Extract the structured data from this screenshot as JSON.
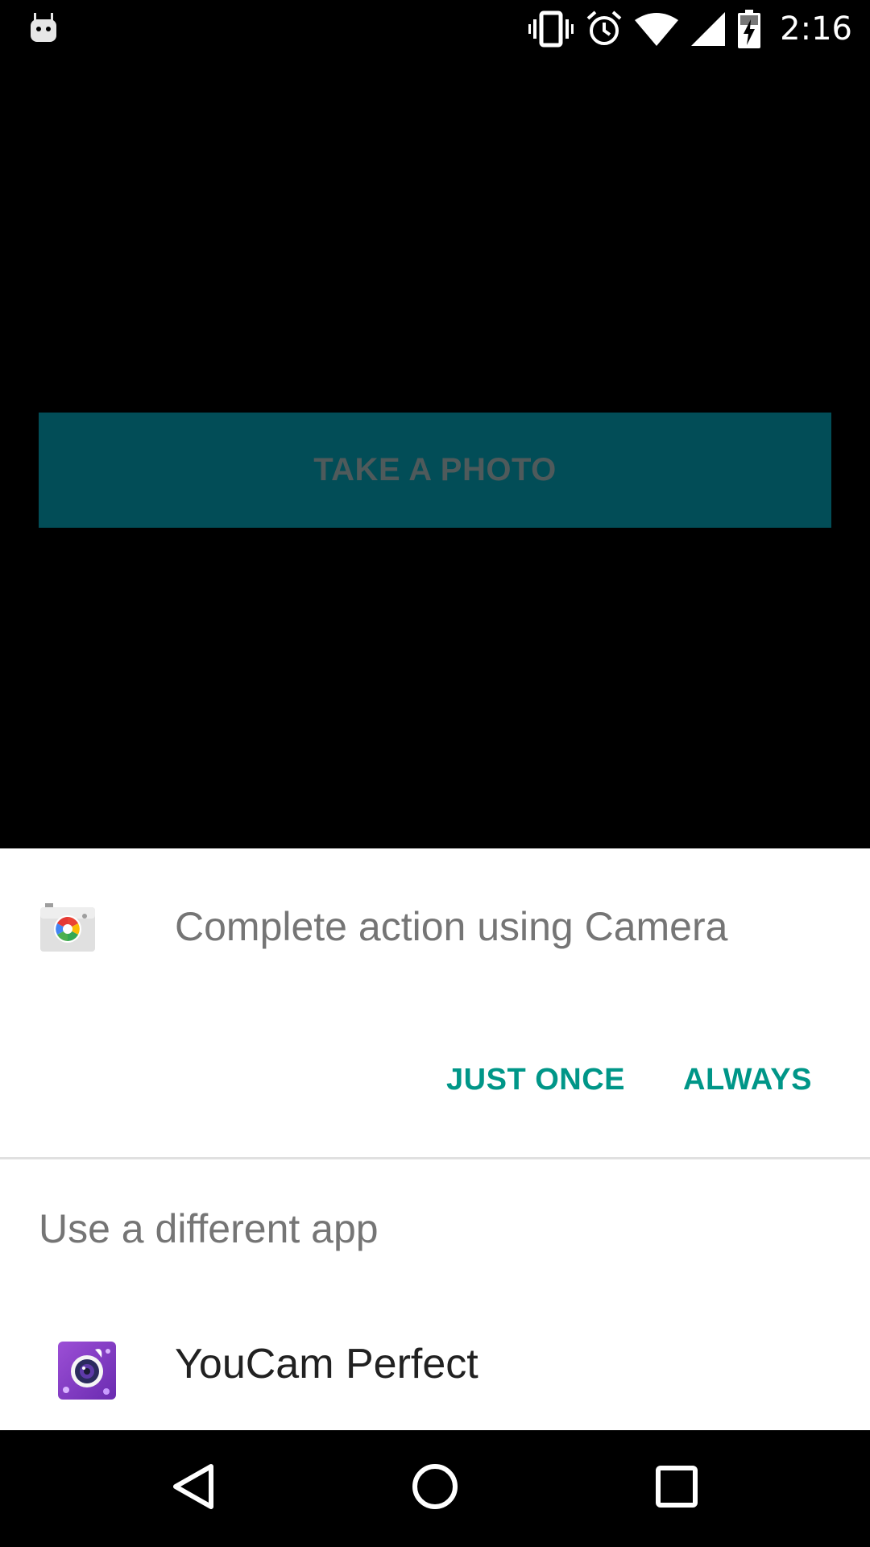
{
  "status_bar": {
    "time": "2:16",
    "icons": [
      "android-debug-icon",
      "vibrate-icon",
      "alarm-icon",
      "wifi-icon",
      "cell-signal-icon",
      "battery-charging-icon"
    ]
  },
  "app": {
    "take_photo_label": "TAKE A PHOTO",
    "button_color": "#024d57"
  },
  "dialog": {
    "title": "Complete action using Camera",
    "default_app_icon": "camera-app-icon",
    "buttons": {
      "just_once": "JUST ONCE",
      "always": "ALWAYS"
    },
    "button_color": "#009688",
    "section_header": "Use a different app",
    "apps": [
      {
        "label": "YouCam Perfect",
        "icon": "youcam-perfect-icon"
      }
    ]
  },
  "nav_bar": {
    "buttons": [
      "back-icon",
      "home-icon",
      "recents-icon"
    ]
  }
}
